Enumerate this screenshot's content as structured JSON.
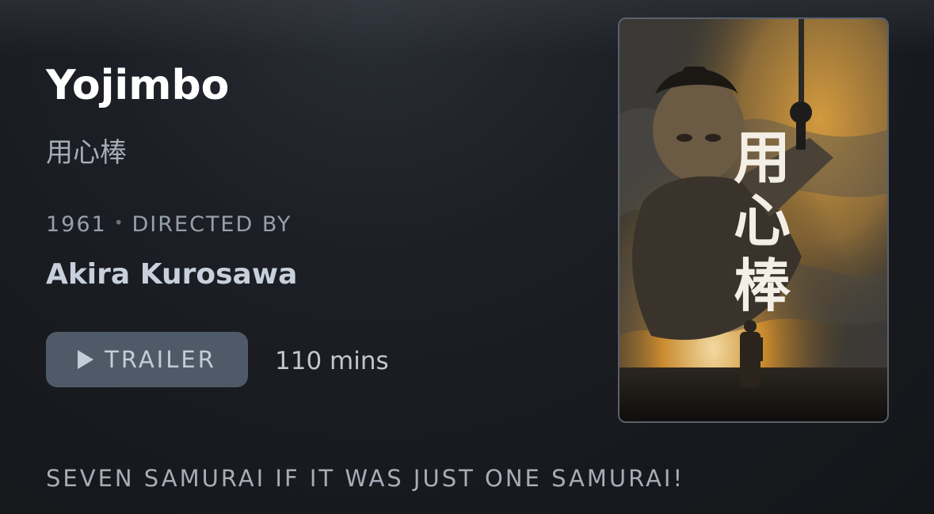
{
  "movie": {
    "title": "Yojimbo",
    "original_title": "用心棒",
    "year": "1961",
    "separator": "•",
    "directed_by_label": "DIRECTED BY",
    "director": "Akira Kurosawa",
    "runtime": "110 mins",
    "tagline": "SEVEN SAMURAI IF IT WAS JUST ONE SAMURAI!"
  },
  "actions": {
    "trailer_label": "TRAILER",
    "trailer_icon": "play-icon"
  },
  "poster": {
    "calligraphy": [
      "用",
      "心",
      "棒"
    ],
    "dominant_colors": {
      "amber": "#c98a2e",
      "smoke": "#4a4a4a",
      "shadow": "#151412"
    }
  },
  "colors": {
    "background": "#1c1f25",
    "button": "#4f5a69",
    "title": "#ffffff",
    "secondary_text": "#98a0ac"
  }
}
